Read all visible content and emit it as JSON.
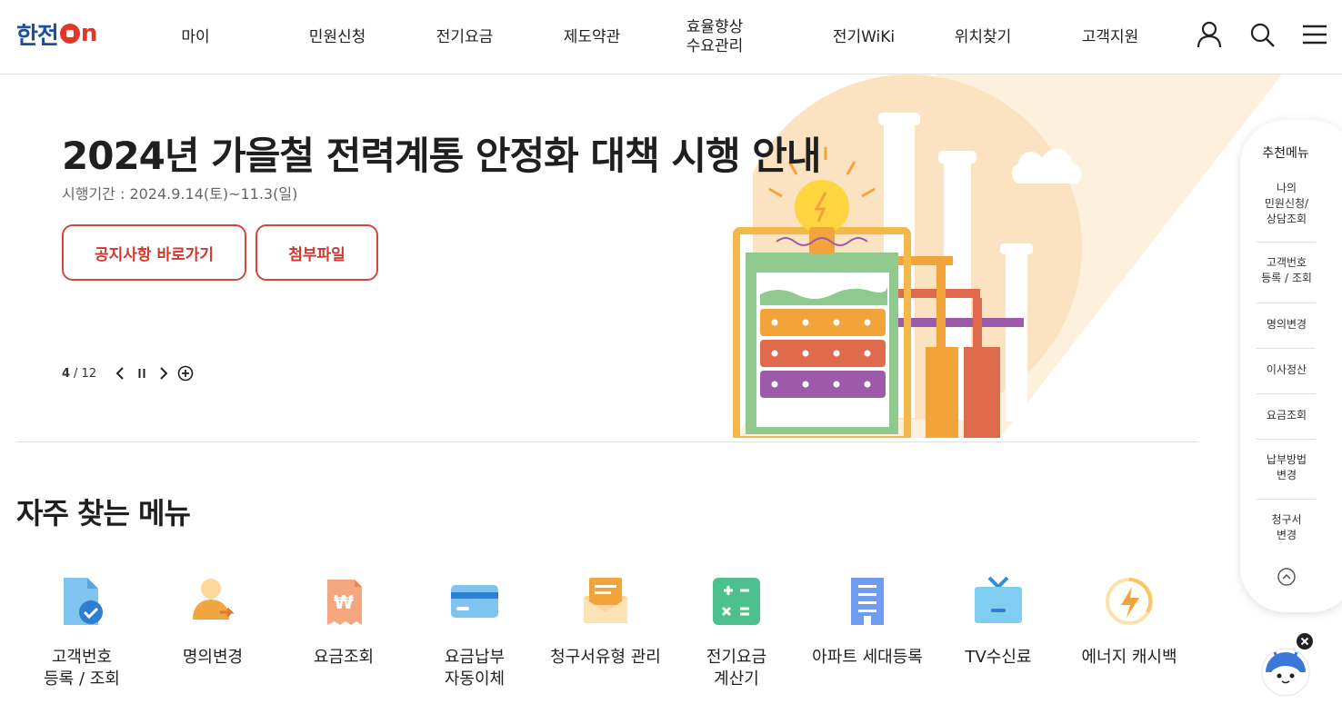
{
  "header": {
    "logo_main": "한전",
    "logo_on": "n",
    "nav": [
      {
        "label": "마이"
      },
      {
        "label": "민원신청"
      },
      {
        "label": "전기요금"
      },
      {
        "label": "제도약관"
      },
      {
        "label": "효율향상\n수요관리"
      },
      {
        "label": "전기WiKi"
      },
      {
        "label": "위치찾기"
      },
      {
        "label": "고객지원"
      }
    ],
    "icons": [
      "user-icon",
      "search-icon",
      "menu-icon"
    ]
  },
  "hero": {
    "title": "2024년 가을철 전력계통 안정화 대책 시행 안내",
    "subtitle": "시행기간 : 2024.9.14(토)~11.3(일)",
    "notice_button": "공지사항 바로가기",
    "attach_button": "첨부파일",
    "pager_current": "4",
    "pager_total": "/ 12"
  },
  "frequent": {
    "title": "자주 찾는 메뉴",
    "items": [
      {
        "label": "고객번호\n등록 / 조회",
        "icon": "customer-number-icon"
      },
      {
        "label": "명의변경",
        "icon": "name-change-icon"
      },
      {
        "label": "요금조회",
        "icon": "bill-inquiry-icon"
      },
      {
        "label": "요금납부\n자동이체",
        "icon": "card-icon"
      },
      {
        "label": "청구서유형 관리",
        "icon": "envelope-icon"
      },
      {
        "label": "전기요금\n계산기",
        "icon": "calculator-icon"
      },
      {
        "label": "아파트 세대등록",
        "icon": "apartment-icon"
      },
      {
        "label": "TV수신료",
        "icon": "tv-icon"
      },
      {
        "label": "에너지 캐시백",
        "icon": "energy-cashback-icon"
      }
    ]
  },
  "side_menu": {
    "title": "추천메뉴",
    "items": [
      {
        "label": "나의\n민원신청/\n상담조회"
      },
      {
        "label": "고객번호\n등록 / 조회"
      },
      {
        "label": "명의변경"
      },
      {
        "label": "이사정산"
      },
      {
        "label": "요금조회"
      },
      {
        "label": "납부방법\n변경"
      },
      {
        "label": "청구서\n변경"
      }
    ]
  },
  "colors": {
    "brand_blue": "#1d4f9c",
    "brand_red": "#e0362c",
    "button_red": "#d0372f"
  }
}
